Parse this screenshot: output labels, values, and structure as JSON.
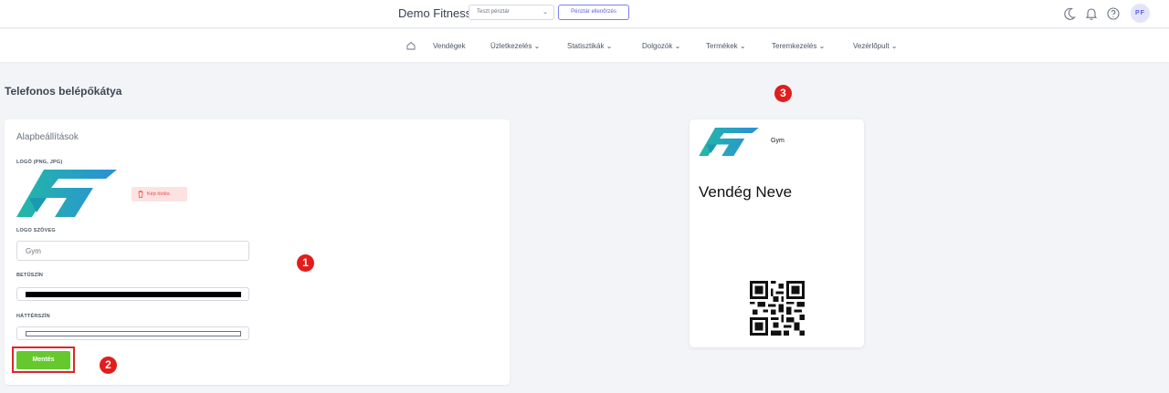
{
  "header": {
    "brand": "Demo Fitness",
    "register_select": "Teszt pénztár",
    "register_check_label": "Pénztár ellenőrzés",
    "avatar_initials": "PF",
    "icons": [
      "moon-icon",
      "bell-icon",
      "help-icon"
    ]
  },
  "nav": {
    "items": [
      {
        "label": "Vendégek"
      },
      {
        "label": "Üzletkezelés ⌄"
      },
      {
        "label": "Statisztikák ⌄"
      },
      {
        "label": "Dolgozók ⌄"
      },
      {
        "label": "Termékek ⌄"
      },
      {
        "label": "Teremkezelés ⌄"
      },
      {
        "label": "Vezérlőpult ⌄"
      }
    ]
  },
  "page": {
    "title": "Telefonos belépőkátya"
  },
  "settings": {
    "card_title": "Alapbeállítások",
    "logo_label": "LOGÓ (PNG, JPG)",
    "delete_image_label": "Kép törlés",
    "logo_text_label": "LOGO SZÖVEG",
    "logo_text_value": "Gym",
    "font_color_label": "BETŰSZÍN",
    "font_color_value": "#000000",
    "bg_color_label": "HÁTTÉRSZÍN",
    "bg_color_value": "#ffffff",
    "save_label": "Mentés"
  },
  "annotations": [
    "1",
    "2",
    "3"
  ],
  "preview": {
    "logo_text": "Gym",
    "guest_name": "Vendég Neve"
  },
  "colors": {
    "accent": "#5b5fd6",
    "save_green": "#65c92e",
    "annotation_red": "#e11d1d",
    "logo_teal": "#1fb5b5"
  }
}
